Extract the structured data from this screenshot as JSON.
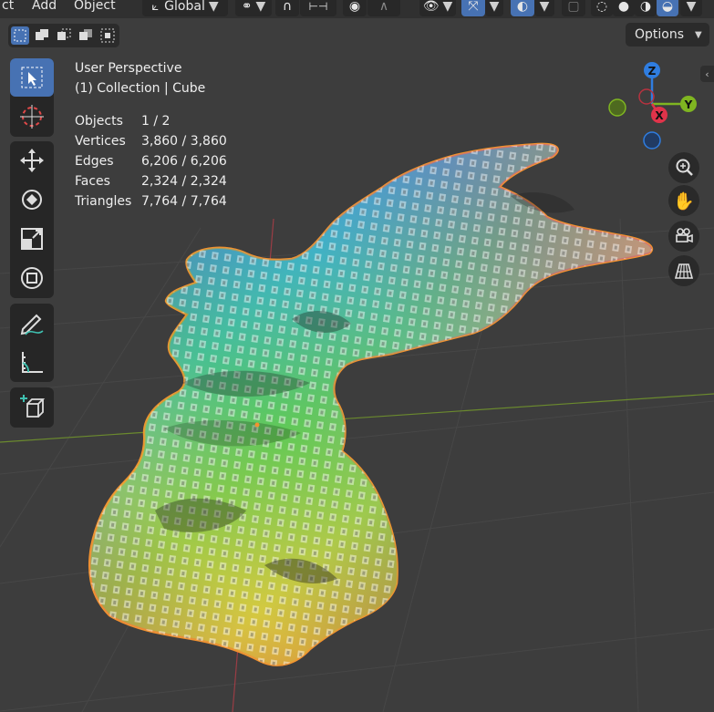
{
  "menu": {
    "item_partial": "ct",
    "add": "Add",
    "object": "Object"
  },
  "header": {
    "transform_orientation": "Global",
    "options_label": "Options"
  },
  "viewport": {
    "view_name": "User Perspective",
    "collection_line": "(1) Collection | Cube",
    "stats": [
      {
        "label": "Objects",
        "value": "1 / 2"
      },
      {
        "label": "Vertices",
        "value": "3,860 / 3,860"
      },
      {
        "label": "Edges",
        "value": "6,206 / 6,206"
      },
      {
        "label": "Faces",
        "value": "2,324 / 2,324"
      },
      {
        "label": "Triangles",
        "value": "7,764 / 7,764"
      }
    ]
  },
  "gizmo": {
    "z_label": "Z",
    "y_label": "Y",
    "x_label": "X",
    "x_color": "#e0334a",
    "y_color": "#7fb521",
    "z_color": "#2f7de0"
  },
  "toolbar": {
    "tools": [
      "select-box",
      "cursor",
      "move",
      "rotate",
      "scale",
      "transform",
      "annotate",
      "measure",
      "add-cube"
    ],
    "active_tool": "select-box"
  },
  "colors": {
    "accent": "#4772b3",
    "outline": "#f2922f",
    "grid": "#474747"
  }
}
